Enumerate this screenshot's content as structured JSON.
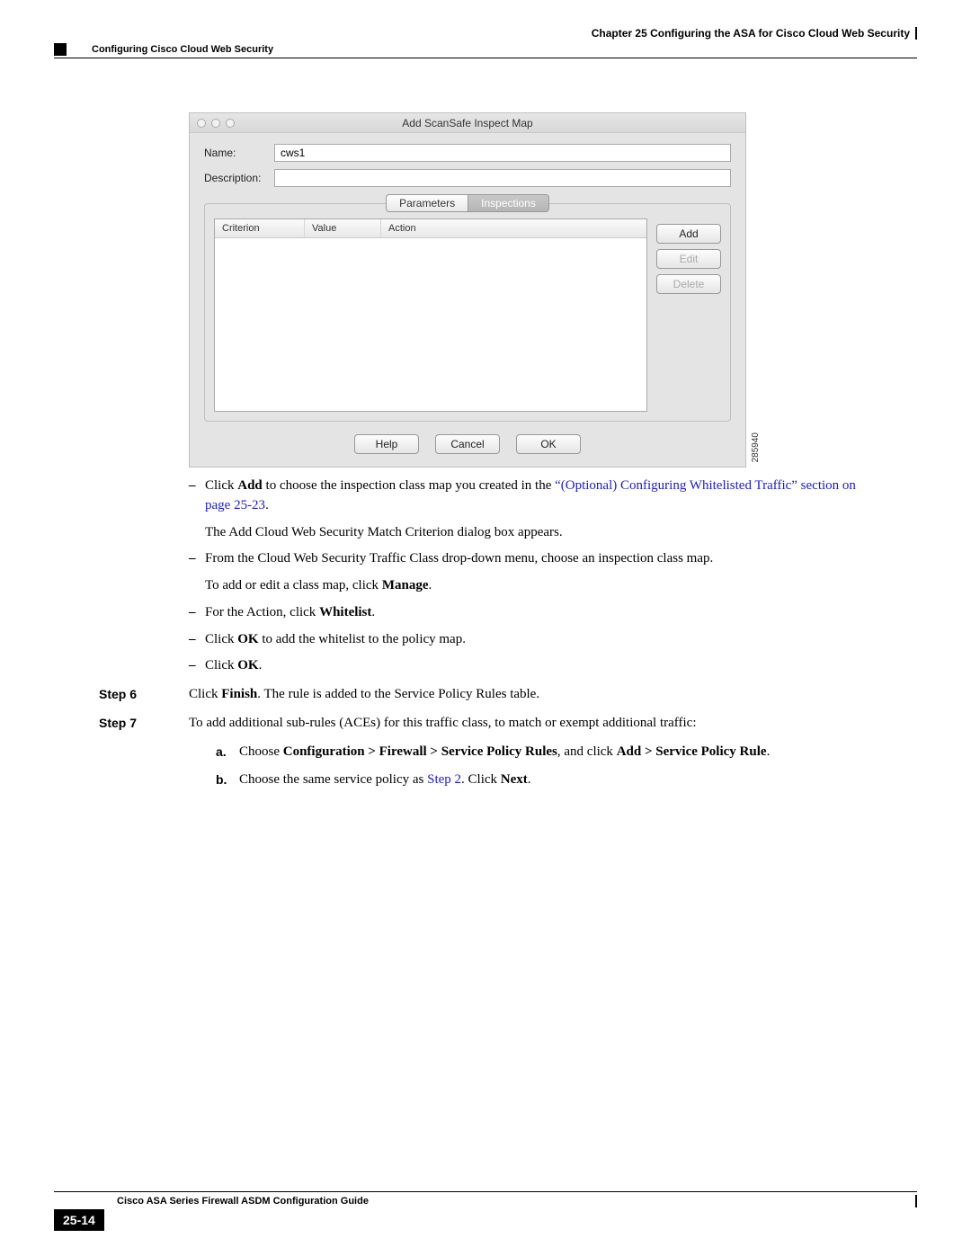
{
  "header": {
    "chapter": "Chapter 25    Configuring the ASA for Cisco Cloud Web Security",
    "section": "Configuring Cisco Cloud Web Security"
  },
  "dialog": {
    "title": "Add ScanSafe Inspect Map",
    "nameLabel": "Name:",
    "nameValue": "cws1",
    "descLabel": "Description:",
    "descValue": "",
    "tabs": {
      "parameters": "Parameters",
      "inspections": "Inspections"
    },
    "columns": {
      "criterion": "Criterion",
      "value": "Value",
      "action": "Action"
    },
    "buttons": {
      "add": "Add",
      "edit": "Edit",
      "delete": "Delete",
      "help": "Help",
      "cancel": "Cancel",
      "ok": "OK"
    },
    "figno": "285940"
  },
  "body": {
    "d1a": "Click ",
    "d1b": "Add",
    "d1c": " to choose the inspection class map you created in the ",
    "d1link": "“(Optional) Configuring Whitelisted Traffic” section on page 25-23",
    "d1d": ".",
    "d1p2": "The Add Cloud Web Security Match Criterion dialog box appears.",
    "d2a": "From the Cloud Web Security Traffic Class drop-down menu, choose an inspection class map.",
    "d2b": "To add or edit a class map, click ",
    "d2c": "Manage",
    "d2d": ".",
    "d3a": "For the Action, click ",
    "d3b": "Whitelist",
    "d3c": ".",
    "d4a": "Click ",
    "d4b": "OK",
    "d4c": " to add the whitelist to the policy map.",
    "d5a": "Click ",
    "d5b": "OK",
    "d5c": ".",
    "step6Label": "Step 6",
    "step6a": "Click ",
    "step6b": "Finish",
    "step6c": ". The rule is added to the Service Policy Rules table.",
    "step7Label": "Step 7",
    "step7": "To add additional sub-rules (ACEs) for this traffic class, to match or exempt additional traffic:",
    "s7aLabel": "a.",
    "s7a1": "Choose ",
    "s7a2": "Configuration > Firewall > Service Policy Rules",
    "s7a3": ", and click ",
    "s7a4": "Add > Service Policy Rule",
    "s7a5": ".",
    "s7bLabel": "b.",
    "s7b1": "Choose the same service policy as ",
    "s7b2": "Step 2",
    "s7b3": ". Click ",
    "s7b4": "Next",
    "s7b5": "."
  },
  "footer": {
    "guide": "Cisco ASA Series Firewall ASDM Configuration Guide",
    "pageno": "25-14"
  }
}
